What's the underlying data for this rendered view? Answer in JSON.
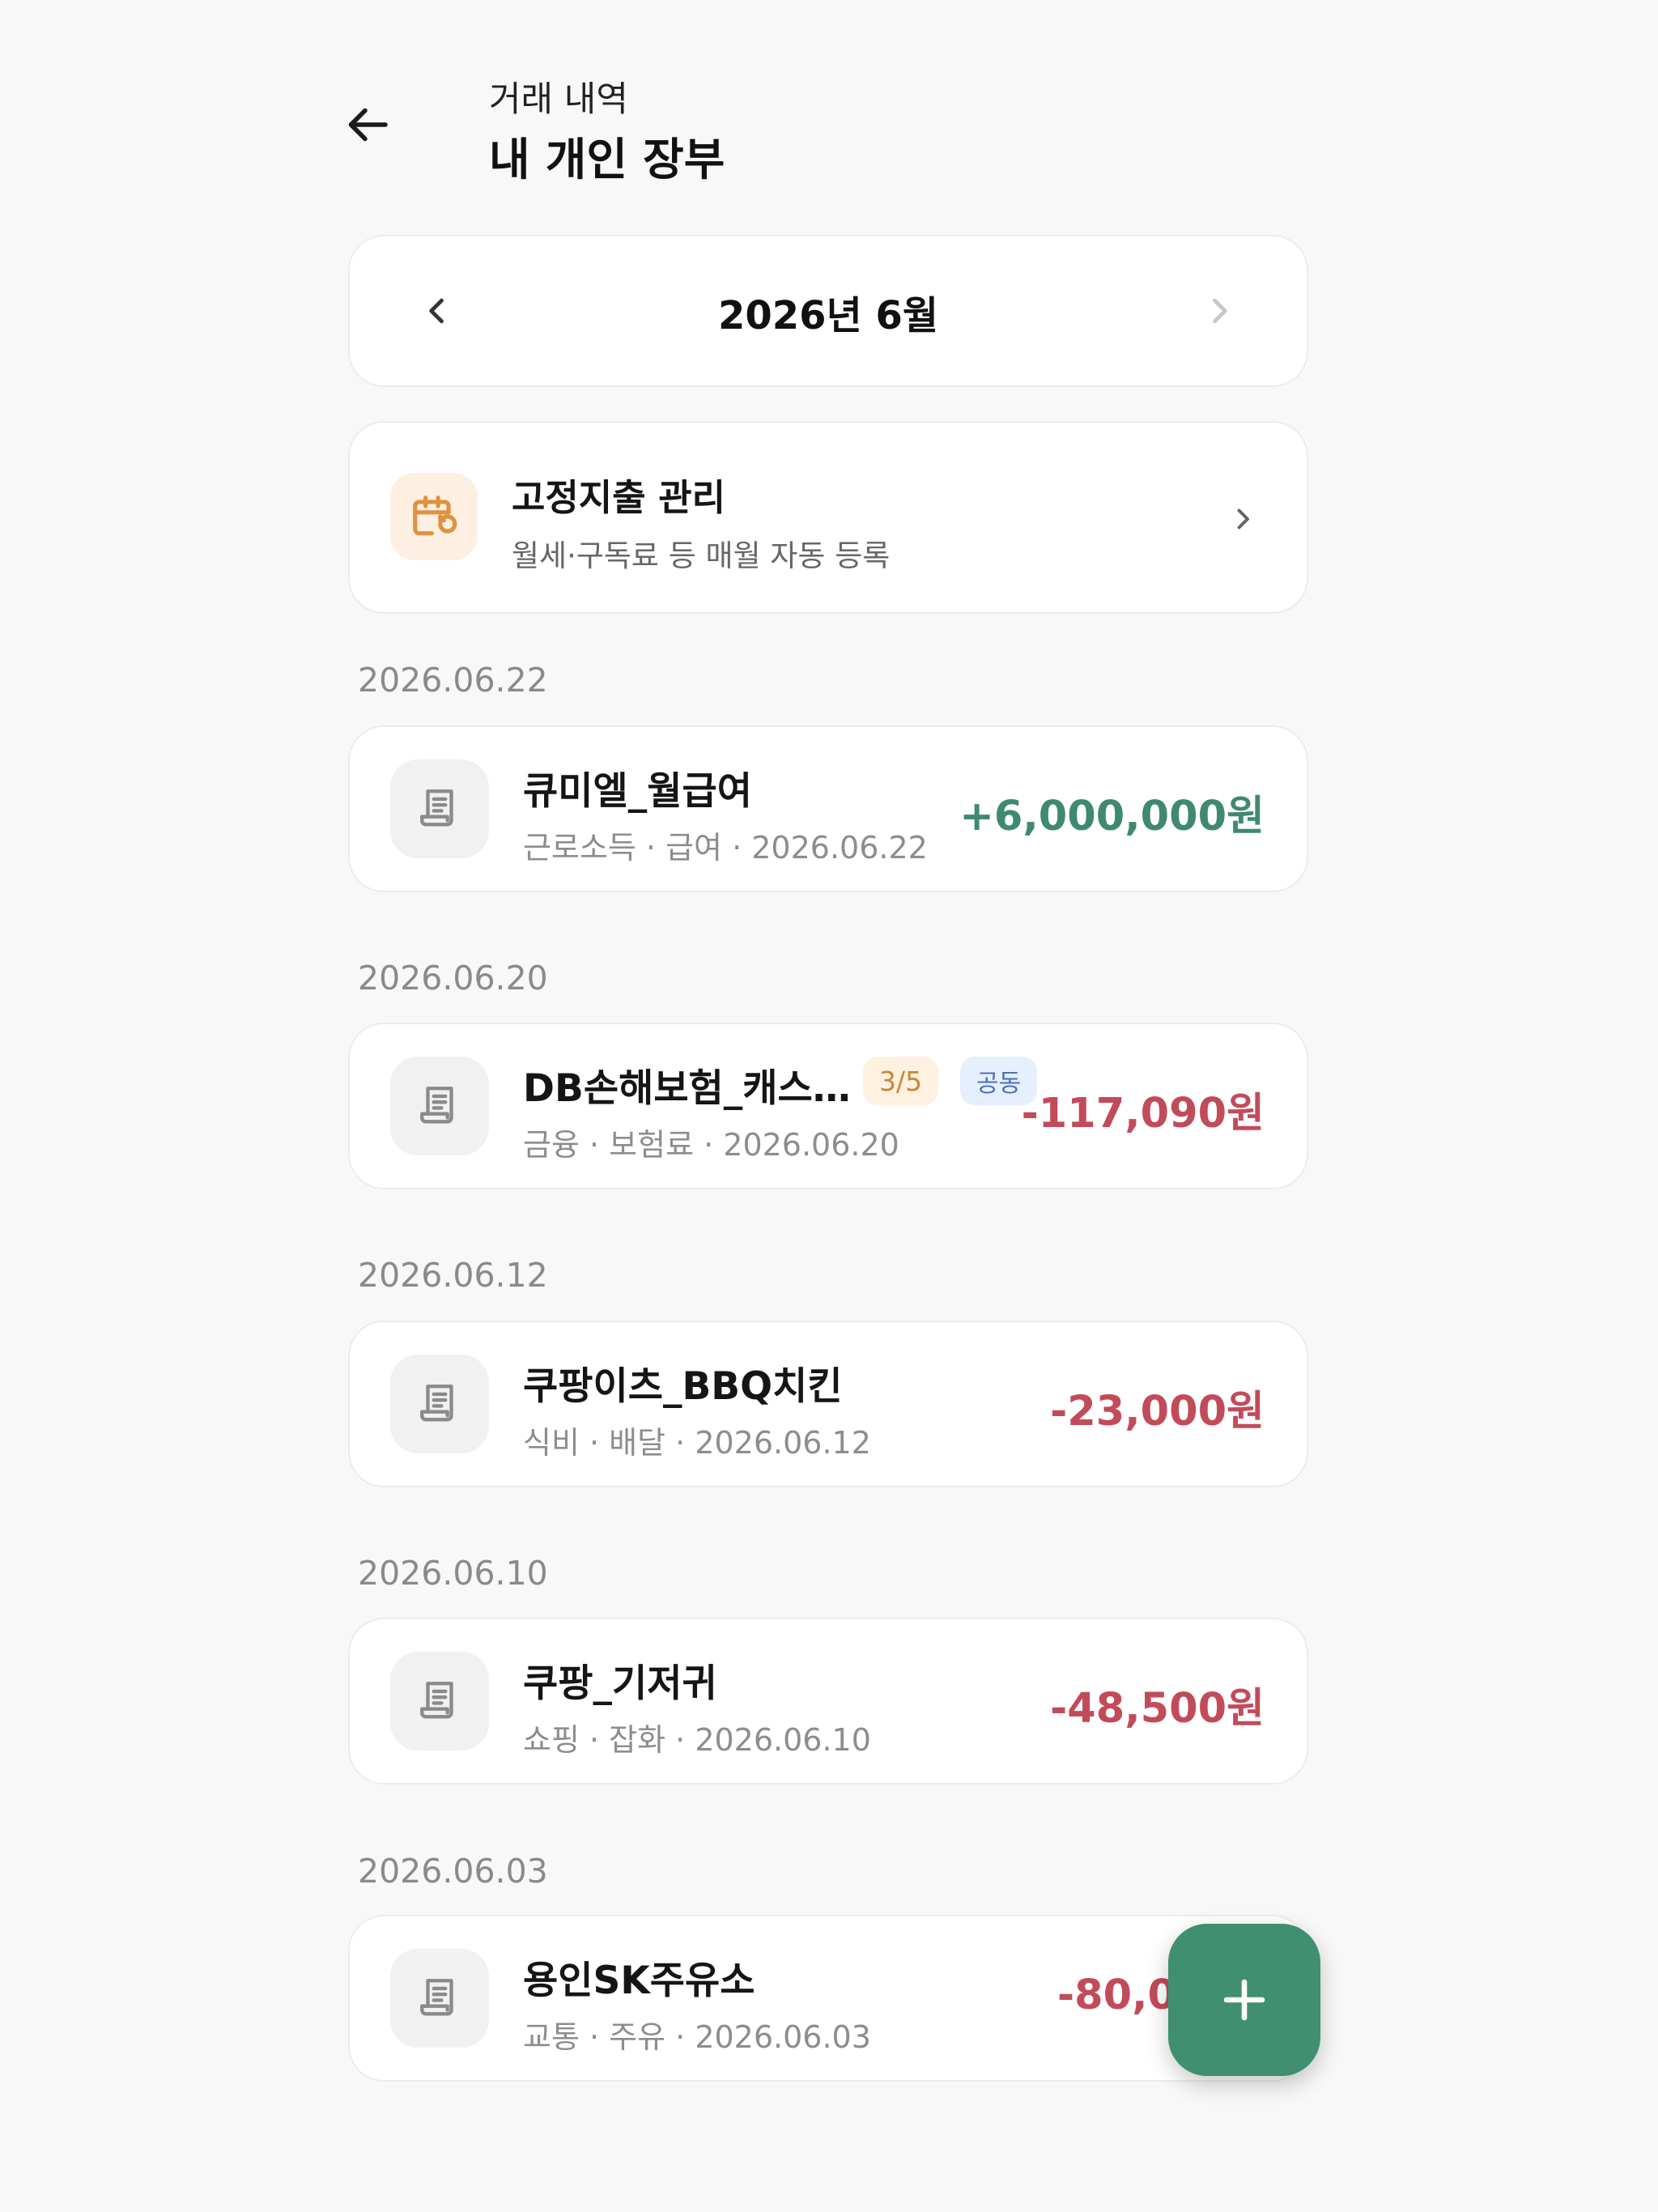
{
  "header": {
    "subtitle": "거래 내역",
    "title": "내 개인 장부"
  },
  "month_selector": {
    "label": "2026년 6월"
  },
  "fixed_expense": {
    "title": "고정지출 관리",
    "description": "월세·구독료 등 매월 자동 등록"
  },
  "groups": [
    {
      "date": "2026.06.22",
      "tx": {
        "name": "큐미엘_월급여",
        "meta": "근로소득 · 급여 · 2026.06.22",
        "amount": "+6,000,000원"
      }
    },
    {
      "date": "2026.06.20",
      "tx": {
        "name": "DB손해보험_캐스…",
        "meta": "금융 · 보험료 · 2026.06.20",
        "amount": "-117,090원",
        "badge_installment": "3/5",
        "badge_shared": "공동"
      }
    },
    {
      "date": "2026.06.12",
      "tx": {
        "name": "쿠팡이츠_BBQ치킨",
        "meta": "식비 · 배달 · 2026.06.12",
        "amount": "-23,000원"
      }
    },
    {
      "date": "2026.06.10",
      "tx": {
        "name": "쿠팡_기저귀",
        "meta": "쇼핑 · 잡화 · 2026.06.10",
        "amount": "-48,500원"
      }
    },
    {
      "date": "2026.06.03",
      "tx": {
        "name": "용인SK주유소",
        "meta": "교통 · 주유 · 2026.06.03",
        "amount": "-80,0"
      }
    }
  ],
  "icons": {
    "back": "arrow-left-icon",
    "prev": "chevron-left-icon",
    "next": "chevron-right-icon",
    "fixed": "calendar-repeat-icon",
    "receipt": "receipt-icon",
    "fab": "plus-icon"
  },
  "colors": {
    "income": "#3f8a6e",
    "expense": "#c24b5a",
    "fab": "#3f8f70",
    "accent_orange": "#e0913f"
  }
}
